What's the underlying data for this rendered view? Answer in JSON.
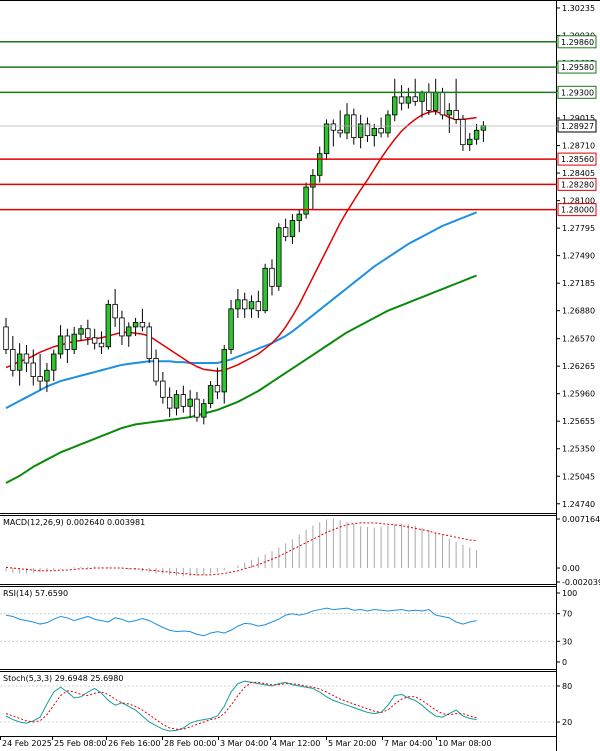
{
  "chart_data": {
    "type": "candlestick",
    "price_axis": {
      "ticks": [
        "1.30235",
        "1.29930",
        "1.29625",
        "1.29315",
        "1.29015",
        "1.28710",
        "1.28405",
        "1.28100",
        "1.27795",
        "1.27490",
        "1.27185",
        "1.26880",
        "1.26570",
        "1.26265",
        "1.25960",
        "1.25655",
        "1.25350",
        "1.25045",
        "1.24740"
      ],
      "range": [
        1.2466,
        1.3029
      ]
    },
    "levels": [
      {
        "label": "1.29860",
        "value": 1.2986,
        "color": "#1a7a1a"
      },
      {
        "label": "1.29580",
        "value": 1.2958,
        "color": "#1a7a1a"
      },
      {
        "label": "1.29300",
        "value": 1.293,
        "color": "#1a7a1a"
      },
      {
        "label": "1.28560",
        "value": 1.2856,
        "color": "#e00000"
      },
      {
        "label": "1.28280",
        "value": 1.2828,
        "color": "#e00000"
      },
      {
        "label": "1.28000",
        "value": 1.28,
        "color": "#e00000"
      }
    ],
    "current_price": {
      "label": "1.28927",
      "value": 1.28927
    },
    "x_labels": [
      "24 Feb 2025",
      "25 Feb 08:00",
      "26 Feb 16:00",
      "28 Feb 00:00",
      "3 Mar 04:00",
      "4 Mar 12:00",
      "5 Mar 20:00",
      "7 Mar 04:00",
      "10 Mar 08:00"
    ],
    "candles": [
      [
        1.267,
        1.268,
        1.264,
        1.2645
      ],
      [
        1.2645,
        1.266,
        1.2615,
        1.2622
      ],
      [
        1.2622,
        1.2652,
        1.2605,
        1.264
      ],
      [
        1.264,
        1.265,
        1.262,
        1.263
      ],
      [
        1.263,
        1.2645,
        1.2605,
        1.2615
      ],
      [
        1.2615,
        1.264,
        1.26,
        1.261
      ],
      [
        1.261,
        1.263,
        1.2598,
        1.2622
      ],
      [
        1.2622,
        1.2645,
        1.261,
        1.264
      ],
      [
        1.264,
        1.2672,
        1.2635,
        1.266
      ],
      [
        1.266,
        1.2668,
        1.263,
        1.2645
      ],
      [
        1.2645,
        1.267,
        1.264,
        1.2662
      ],
      [
        1.2662,
        1.2672,
        1.2655,
        1.2668
      ],
      [
        1.2668,
        1.2678,
        1.265,
        1.2658
      ],
      [
        1.2658,
        1.2668,
        1.2645,
        1.2652
      ],
      [
        1.2652,
        1.2665,
        1.264,
        1.2648
      ],
      [
        1.2648,
        1.27,
        1.2645,
        1.2695
      ],
      [
        1.2695,
        1.2712,
        1.267,
        1.268
      ],
      [
        1.268,
        1.2688,
        1.265,
        1.266
      ],
      [
        1.266,
        1.2675,
        1.2648,
        1.267
      ],
      [
        1.267,
        1.268,
        1.266,
        1.2675
      ],
      [
        1.2675,
        1.269,
        1.2665,
        1.267
      ],
      [
        1.267,
        1.2675,
        1.263,
        1.2635
      ],
      [
        1.2635,
        1.2645,
        1.2605,
        1.261
      ],
      [
        1.261,
        1.262,
        1.2585,
        1.2592
      ],
      [
        1.2592,
        1.2603,
        1.257,
        1.258
      ],
      [
        1.258,
        1.26,
        1.2572,
        1.2595
      ],
      [
        1.2595,
        1.2605,
        1.2575,
        1.2582
      ],
      [
        1.2582,
        1.26,
        1.257,
        1.259
      ],
      [
        1.259,
        1.2598,
        1.2565,
        1.257
      ],
      [
        1.257,
        1.259,
        1.2562,
        1.2585
      ],
      [
        1.2585,
        1.261,
        1.258,
        1.2605
      ],
      [
        1.2605,
        1.2625,
        1.259,
        1.2598
      ],
      [
        1.2598,
        1.265,
        1.2585,
        1.2645
      ],
      [
        1.2645,
        1.27,
        1.264,
        1.269
      ],
      [
        1.269,
        1.2712,
        1.268,
        1.27
      ],
      [
        1.27,
        1.2708,
        1.268,
        1.269
      ],
      [
        1.269,
        1.2705,
        1.268,
        1.2698
      ],
      [
        1.2698,
        1.271,
        1.268,
        1.2688
      ],
      [
        1.2688,
        1.274,
        1.2685,
        1.2735
      ],
      [
        1.2735,
        1.2745,
        1.2705,
        1.2715
      ],
      [
        1.2715,
        1.2785,
        1.271,
        1.278
      ],
      [
        1.278,
        1.279,
        1.2765,
        1.277
      ],
      [
        1.277,
        1.2795,
        1.2762,
        1.2788
      ],
      [
        1.2788,
        1.28,
        1.2775,
        1.2795
      ],
      [
        1.2795,
        1.283,
        1.279,
        1.2825
      ],
      [
        1.2825,
        1.2845,
        1.28,
        1.2838
      ],
      [
        1.2838,
        1.287,
        1.283,
        1.2862
      ],
      [
        1.2862,
        1.29,
        1.2855,
        1.2895
      ],
      [
        1.2895,
        1.29,
        1.287,
        1.2888
      ],
      [
        1.2888,
        1.291,
        1.288,
        1.2885
      ],
      [
        1.2885,
        1.2918,
        1.2878,
        1.2905
      ],
      [
        1.2905,
        1.2912,
        1.2872,
        1.288
      ],
      [
        1.288,
        1.2905,
        1.2868,
        1.2895
      ],
      [
        1.2895,
        1.2902,
        1.2875,
        1.2882
      ],
      [
        1.2882,
        1.2895,
        1.287,
        1.289
      ],
      [
        1.289,
        1.2902,
        1.288,
        1.2885
      ],
      [
        1.2885,
        1.291,
        1.288,
        1.2905
      ],
      [
        1.2905,
        1.2945,
        1.2898,
        1.2925
      ],
      [
        1.2925,
        1.2938,
        1.291,
        1.2918
      ],
      [
        1.2918,
        1.2935,
        1.2912,
        1.2925
      ],
      [
        1.2925,
        1.2945,
        1.2915,
        1.292
      ],
      [
        1.292,
        1.2932,
        1.2902,
        1.293
      ],
      [
        1.293,
        1.294,
        1.2905,
        1.291
      ],
      [
        1.291,
        1.2945,
        1.2905,
        1.293
      ],
      [
        1.293,
        1.2935,
        1.29,
        1.2905
      ],
      [
        1.2905,
        1.2918,
        1.2885,
        1.291
      ],
      [
        1.291,
        1.2945,
        1.2895,
        1.29
      ],
      [
        1.29,
        1.2905,
        1.2865,
        1.2872
      ],
      [
        1.2872,
        1.2885,
        1.2865,
        1.2878
      ],
      [
        1.2878,
        1.2895,
        1.2872,
        1.2888
      ],
      [
        1.2888,
        1.2898,
        1.2875,
        1.2893
      ]
    ],
    "ma_fast": [
      1.2625,
      1.2628,
      1.2632,
      1.2634,
      1.2638,
      1.2642,
      1.2645,
      1.2648,
      1.265,
      1.2652,
      1.2654,
      1.2655,
      1.2656,
      1.2657,
      1.2658,
      1.266,
      1.2662,
      1.2664,
      1.2664,
      1.2663,
      1.2662,
      1.266,
      1.2655,
      1.265,
      1.2645,
      1.264,
      1.2635,
      1.263,
      1.2626,
      1.2623,
      1.2622,
      1.2621,
      1.2622,
      1.2625,
      1.2628,
      1.2632,
      1.2636,
      1.264,
      1.2646,
      1.2652,
      1.266,
      1.267,
      1.2682,
      1.2695,
      1.271,
      1.2725,
      1.274,
      1.2755,
      1.277,
      1.2785,
      1.2798,
      1.281,
      1.2822,
      1.2833,
      1.2845,
      1.2857,
      1.2868,
      1.2878,
      1.2887,
      1.2894,
      1.29,
      1.2905,
      1.2908,
      1.2909,
      1.2906,
      1.2902,
      1.29,
      1.29,
      1.2901,
      1.2902
    ],
    "ma_mid": [
      1.258,
      1.2584,
      1.2588,
      1.2592,
      1.2596,
      1.26,
      1.2604,
      1.2607,
      1.261,
      1.2612,
      1.2614,
      1.2616,
      1.2618,
      1.262,
      1.2622,
      1.2624,
      1.2626,
      1.2628,
      1.2629,
      1.263,
      1.2631,
      1.2632,
      1.2632,
      1.2632,
      1.2632,
      1.2631,
      1.2631,
      1.263,
      1.263,
      1.263,
      1.263,
      1.263,
      1.2632,
      1.2634,
      1.2637,
      1.264,
      1.2643,
      1.2646,
      1.2649,
      1.2652,
      1.2656,
      1.266,
      1.2665,
      1.2671,
      1.2677,
      1.2683,
      1.2689,
      1.2695,
      1.2701,
      1.2707,
      1.2713,
      1.2719,
      1.2725,
      1.2731,
      1.2737,
      1.2742,
      1.2747,
      1.2752,
      1.2757,
      1.2762,
      1.2766,
      1.277,
      1.2774,
      1.2778,
      1.2782,
      1.2785,
      1.2788,
      1.2791,
      1.2794,
      1.2797
    ],
    "ma_slow": [
      1.2497,
      1.2501,
      1.2505,
      1.251,
      1.2515,
      1.2519,
      1.2523,
      1.2527,
      1.2531,
      1.2534,
      1.2537,
      1.254,
      1.2543,
      1.2546,
      1.2549,
      1.2552,
      1.2555,
      1.2558,
      1.256,
      1.2562,
      1.2563,
      1.2564,
      1.2565,
      1.2566,
      1.2567,
      1.2568,
      1.2569,
      1.257,
      1.2572,
      1.2574,
      1.2576,
      1.2578,
      1.2581,
      1.2584,
      1.2587,
      1.2591,
      1.2595,
      1.2599,
      1.2604,
      1.2609,
      1.2614,
      1.2619,
      1.2624,
      1.2629,
      1.2634,
      1.2639,
      1.2644,
      1.2649,
      1.2654,
      1.2659,
      1.2664,
      1.2668,
      1.2672,
      1.2676,
      1.268,
      1.2684,
      1.2688,
      1.2691,
      1.2694,
      1.2697,
      1.27,
      1.2703,
      1.2706,
      1.2709,
      1.2712,
      1.2715,
      1.2718,
      1.2721,
      1.2724,
      1.2727
    ],
    "macd": {
      "title": "MACD(12,26,9) 0.002640 0.003981",
      "ticks": [
        "0.007164",
        "0.00",
        "-0.002039"
      ],
      "range": [
        -0.002039,
        0.007164
      ],
      "histogram": [
        -0.0005,
        -0.0007,
        -0.0008,
        -0.0008,
        -0.0007,
        -0.0006,
        -0.0005,
        -0.0003,
        -0.0001,
        0.0,
        0.0001,
        0.0002,
        0.0002,
        0.0002,
        0.0001,
        0.0001,
        0.0,
        -0.0001,
        -0.0002,
        -0.0003,
        -0.0005,
        -0.0006,
        -0.0008,
        -0.0009,
        -0.001,
        -0.0011,
        -0.0012,
        -0.0012,
        -0.0011,
        -0.001,
        -0.0008,
        -0.0006,
        -0.0003,
        0.0,
        0.0004,
        0.0008,
        0.0012,
        0.0016,
        0.002,
        0.0025,
        0.003,
        0.0036,
        0.0042,
        0.0049,
        0.0056,
        0.0062,
        0.0067,
        0.0071,
        0.0072,
        0.007,
        0.0067,
        0.0064,
        0.0061,
        0.006,
        0.0059,
        0.006,
        0.0062,
        0.0064,
        0.0065,
        0.0064,
        0.0062,
        0.0059,
        0.0056,
        0.0052,
        0.0048,
        0.0043,
        0.0038,
        0.0034,
        0.003,
        0.0026
      ],
      "signal": [
        0.0001,
        0.0,
        -0.0001,
        -0.0002,
        -0.0003,
        -0.0004,
        -0.0004,
        -0.0004,
        -0.0003,
        -0.0003,
        -0.0002,
        -0.0001,
        -0.0001,
        0.0,
        0.0,
        0.0,
        0.0,
        0.0,
        -0.0001,
        -0.0001,
        -0.0002,
        -0.0003,
        -0.0004,
        -0.0005,
        -0.0006,
        -0.0007,
        -0.0008,
        -0.0009,
        -0.001,
        -0.001,
        -0.001,
        -0.0009,
        -0.0008,
        -0.0006,
        -0.0004,
        -0.0001,
        0.0002,
        0.0005,
        0.0009,
        0.0013,
        0.0017,
        0.0022,
        0.0027,
        0.0032,
        0.0037,
        0.0042,
        0.0047,
        0.0052,
        0.0056,
        0.006,
        0.0063,
        0.0065,
        0.0066,
        0.0066,
        0.0066,
        0.0065,
        0.0064,
        0.0063,
        0.0062,
        0.006,
        0.0058,
        0.0056,
        0.0054,
        0.0051,
        0.0049,
        0.0047,
        0.0045,
        0.0043,
        0.0041,
        0.004
      ]
    },
    "rsi": {
      "title": "RSI(14) 57.6590",
      "ticks": [
        "100",
        "70",
        "30",
        "0"
      ],
      "range": [
        0,
        100
      ],
      "values": [
        68,
        66,
        62,
        60,
        58,
        55,
        57,
        62,
        66,
        64,
        60,
        63,
        66,
        62,
        60,
        58,
        64,
        62,
        58,
        60,
        63,
        60,
        55,
        50,
        46,
        44,
        45,
        44,
        40,
        38,
        42,
        44,
        42,
        46,
        52,
        56,
        55,
        52,
        54,
        58,
        62,
        68,
        70,
        68,
        70,
        74,
        76,
        78,
        76,
        77,
        78,
        75,
        76,
        74,
        76,
        75,
        74,
        75,
        76,
        74,
        75,
        74,
        76,
        68,
        66,
        64,
        58,
        55,
        58,
        60
      ]
    },
    "stoch": {
      "title": "Stoch(5,3,3) 29.6948 25.6980",
      "ticks": [
        "80",
        "20"
      ],
      "range": [
        0,
        100
      ],
      "k": [
        30,
        24,
        20,
        18,
        22,
        28,
        50,
        70,
        78,
        70,
        60,
        62,
        70,
        76,
        68,
        56,
        48,
        52,
        46,
        40,
        30,
        20,
        14,
        8,
        5,
        6,
        10,
        18,
        22,
        24,
        26,
        30,
        46,
        70,
        84,
        88,
        86,
        84,
        82,
        80,
        84,
        86,
        82,
        80,
        78,
        76,
        70,
        62,
        56,
        52,
        48,
        44,
        40,
        36,
        34,
        36,
        48,
        64,
        66,
        60,
        56,
        48,
        38,
        30,
        28,
        34,
        40,
        30,
        26,
        24
      ],
      "d": [
        34,
        30,
        26,
        22,
        20,
        22,
        32,
        48,
        64,
        72,
        70,
        66,
        64,
        68,
        70,
        66,
        58,
        52,
        50,
        46,
        40,
        32,
        24,
        16,
        10,
        8,
        8,
        12,
        16,
        20,
        24,
        26,
        34,
        48,
        64,
        78,
        86,
        86,
        84,
        82,
        82,
        84,
        84,
        82,
        80,
        78,
        75,
        70,
        64,
        58,
        54,
        50,
        46,
        42,
        38,
        36,
        40,
        50,
        58,
        62,
        62,
        56,
        48,
        40,
        34,
        32,
        34,
        34,
        30,
        27
      ]
    }
  }
}
